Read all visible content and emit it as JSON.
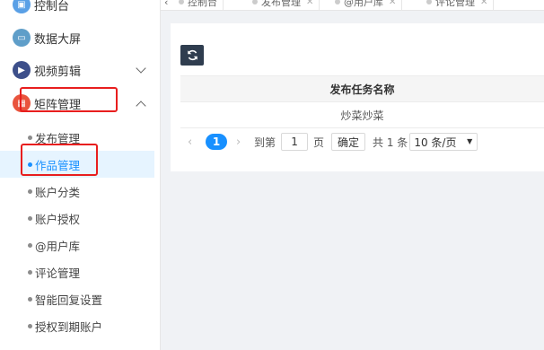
{
  "sidebar": {
    "items": [
      {
        "label": "控制台",
        "icon": "dashboard-icon",
        "color": "#5aa0e6"
      },
      {
        "label": "数据大屏",
        "icon": "screen-icon",
        "color": "#5f9ec9"
      },
      {
        "label": "视频剪辑",
        "icon": "video-edit-icon",
        "color": "#3d4f8a"
      },
      {
        "label": "矩阵管理",
        "icon": "matrix-icon",
        "color": "#e9543d"
      }
    ],
    "sub_items": [
      {
        "label": "发布管理"
      },
      {
        "label": "作品管理"
      },
      {
        "label": "账户分类"
      },
      {
        "label": "账户授权"
      },
      {
        "label": "@用户库"
      },
      {
        "label": "评论管理"
      },
      {
        "label": "智能回复设置"
      },
      {
        "label": "授权到期账户"
      }
    ]
  },
  "tabs": [
    {
      "label": "控制台"
    },
    {
      "label": "发布管理"
    },
    {
      "label": "@用户库"
    },
    {
      "label": "评论管理"
    }
  ],
  "table": {
    "header": "发布任务名称",
    "rows": [
      {
        "name": "炒菜炒菜"
      }
    ]
  },
  "pagination": {
    "current_page": "1",
    "goto_prefix": "到第",
    "goto_value": "1",
    "goto_suffix": "页",
    "confirm_label": "确定",
    "total_text": "共 1 条",
    "page_size": "10 条/页"
  },
  "colors": {
    "accent": "#1890ff",
    "highlight_box": "#e81e1e",
    "refresh_button": "#2f3d4f"
  }
}
